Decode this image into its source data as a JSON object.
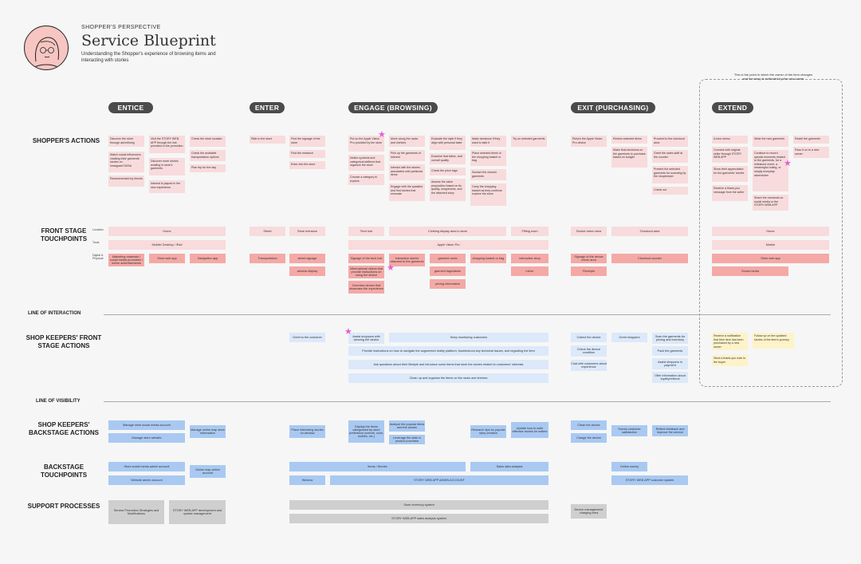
{
  "header": {
    "eyebrow": "SHOPPER'S PERSPECTIVE",
    "title": "Service Blueprint",
    "subtitle": "Understanding the Shopper's experience of browsing items and interacting with stories"
  },
  "phases": [
    "ENTICE",
    "ENTER",
    "ENGAGE (BROWSING)",
    "EXIT (PURCHASING)",
    "EXTEND"
  ],
  "rows": {
    "shoppers_actions": "SHOPPER'S ACTIONS",
    "front_stage": "FRONT STAGE TOUCHPOINTS",
    "line_interaction": "LINE OF INTERACTION",
    "keepers_front": "SHOP KEEPERS' FRONT STAGE ACTIONS",
    "line_visibility": "LINE OF VISIBILITY",
    "keepers_back": "SHOP KEEPERS' BACKSTAGE ACTIONS",
    "backstage_tp": "BACKSTAGE TOUCHPOINTS",
    "support": "SUPPORT PROCESSES"
  },
  "sublabels": {
    "location": "Location",
    "tools": "Tools",
    "digital": "Digital & Physical"
  },
  "extend_note": "This is the point in which the owner of the item changes and the story is extended by the new owner",
  "shopper_cards": {
    "c1": [
      "Discover the store through advertising",
      "Watch social influencers chatting their garments' stories on Instagram/TikTok",
      "Recommended by friends"
    ],
    "c2": [
      "Visit the STORY WEB APP through the link provided in the promotion",
      "Discover more stories availing in store's garments",
      "Interest is piqued in the new experience"
    ],
    "c3": [
      "Check the store location",
      "Check the available transportation options",
      "Plan trip for the day"
    ],
    "c4": [
      "Ride to the store"
    ],
    "c5": [
      "Find the signage of the store",
      "Find the entrance",
      "Enter into the store"
    ],
    "c6": [
      "Put on the Apple Vision Pro provided by the store",
      "Notice symbols and categorical defferes that organize the store",
      "Choose a category to explore"
    ],
    "c7": [
      "Move along the racks and shelves",
      "Pick up the garments of interest",
      "Interact with the stories associated with particular items",
      "Engage with the sparkles and find stories that resonate"
    ],
    "c8": [
      "Evaluate the style if they align with personal taste",
      "Examine that fabric, and overall quality",
      "Check the price tags",
      "Assess the value proposition based on its quality, uniqueness, and the attached story"
    ],
    "c9": [
      "Make decisions if they want to take it",
      "Place selected items in the shopping basket or bag",
      "Scream the chosen garments",
      "Carry the shopping basket as they continue explore the store"
    ],
    "c10": [
      "Try on selected garments"
    ],
    "c11": [
      "Return the Apple Vision Pro device"
    ],
    "c12": [
      "Review selected items",
      "Make final decisions on the garments to purchase based on budget"
    ],
    "c13": [
      "Proceed to the checkout area",
      "Greet the sales staff at the counter",
      "Present the selected garments for scanning by the shopkeeper",
      "Check out"
    ],
    "c14": [
      "A new memo",
      "Connect with original seller through STORY WEB APP",
      "Show their appreciation for the garments' stories",
      "Receive a thank-you message from the seller"
    ],
    "c15": [
      "Wear the new garments",
      "Continue to record special moments related to the garments, for a milestone event, a meaningful outing, or simply everyday adventures",
      "Share the moments on social media or the STORY WEB APP"
    ],
    "c16": [
      "Resell the garments",
      "Pass it on to a new owner"
    ]
  },
  "touchpoints": {
    "home": "Home",
    "mobile": "Mobile/ Desktop / iPad",
    "street": "Street",
    "store_entrance": "Store entrance",
    "tech_hub": "Tech hub",
    "clothing_display": "Clothing display area in store",
    "fitting_room": "Fitting room",
    "device_return": "Device return area",
    "checkout_area": "Checkout area",
    "home2": "Home",
    "apple_vision": "Apple Vision Pro",
    "mobile2": "Mobile",
    "marketing": "Marketing materials / social media promotion / online advertisements",
    "store_web_app": "Store web app",
    "navigation_app": "Navigation app",
    "transportation": "Transportation",
    "street_signage": "street signage",
    "window_display": "window display",
    "signage_tech_hub": "Signage of the tech hub",
    "info_videos": "Informational videos that provide instructions on using the device",
    "overview_demo": "Overview demos that showcase the experience",
    "interactive_stories": "Interactive stories attached to the garments",
    "garment_racks": "garment racks",
    "garment_tags": "garment tags/labels",
    "pricing_info": "pricing information",
    "shopping_basket": "shopping basket or bag",
    "interactive_story": "interactive story",
    "mirror": "mirror",
    "signage_device_return": "Signage of the device return area",
    "receipts": "Receipts",
    "checkout_counter": "Checkout counter",
    "store_web_app2": "Store web app",
    "social_media": "Social media"
  },
  "keepers_front": {
    "greet": "Greet to the customer",
    "assist": "Assist shoppers with wearing the device",
    "keep_monitoring": "Keep monitoring customers",
    "provide_instructions": "Provide instructions on how to navigate the augmented reality platform, troubleshoot any technical issues, and regarding the item",
    "ask_questions": "Ask questions about their lifestyle and introduce some items that store the stories related to customers' interests",
    "clean_up": "Clean up and organize the items on the racks and shelves",
    "collect_device": "Collect the device",
    "check_condition": "Check the device condition",
    "chat_customers": "Chat with customers about experience",
    "greet_shoppers": "Greet shoppers",
    "scan_garments": "Scan the garments for pricing and inventory",
    "pack_garments": "Pack the garments",
    "assist_payment": "Assist shoppers in payment",
    "offer_info": "Offer information about loyalty/referral",
    "receive_notification": "Receive a notification that their item has been purchased by a new owner",
    "send_thanks": "Send a thank-you note to the buyer",
    "follow_up": "Follow up on the updated stories of the item's journey"
  },
  "keepers_back": {
    "manage_social": "Manage store social media account",
    "manage_website": "Manage store website",
    "manage_map": "Manage online map store information",
    "place_stories": "Place interesting stories on window",
    "display_items": "Display the items categorized by store preference (events, color, clothes, etc.)",
    "analyze": "Analyze the popular items and the stories",
    "leverage": "Leverage the data in product purchase",
    "research": "Research tips for popular story creation",
    "update_write": "Update how to write effective stories for sellers",
    "clean_device": "Clean the device",
    "charge_device": "Charge the device",
    "survey": "Survey customer satisfaction",
    "reflect": "Reflect feedback and improve the service"
  },
  "backstage_tp": {
    "social_account": "Store social media admin account",
    "website_admin": "Website admin account",
    "map_admin": "Online map admin account",
    "items_stories": "Items / Stories",
    "sales_data": "Sales data analysis",
    "window": "Window",
    "story_admin": "STORY WEB APP ADMIN ACCOUNT",
    "online_survey": "Online survey",
    "customer_system": "STORY WEB APP customer system"
  },
  "support": {
    "service_promotion": "Service Promotion Strategies and Modifications",
    "app_dev": "STORY WEB APP development and update management",
    "inventory": "Store inventory system",
    "analysis_system": "STORY WEB APP sales analysis system",
    "device_mgmt": "Device management/ charging area"
  }
}
